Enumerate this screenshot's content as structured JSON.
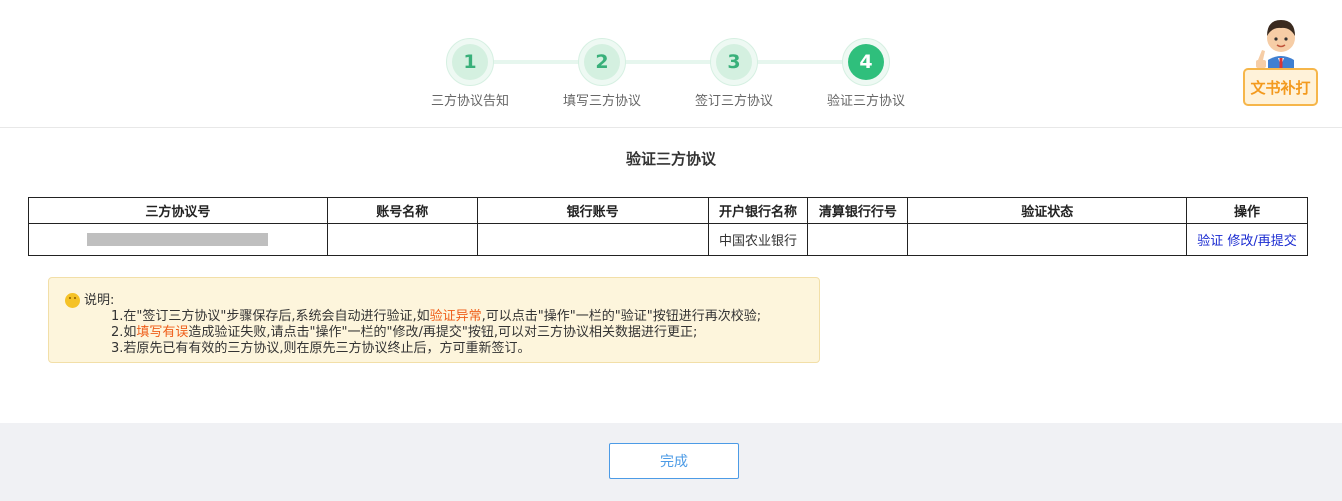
{
  "steps": [
    {
      "number": "1",
      "label": "三方协议告知"
    },
    {
      "number": "2",
      "label": "填写三方协议"
    },
    {
      "number": "3",
      "label": "签订三方协议"
    },
    {
      "number": "4",
      "label": "验证三方协议"
    }
  ],
  "active_step": 4,
  "badge": {
    "label": "文书补打"
  },
  "page_title": "验证三方协议",
  "table": {
    "headers": [
      "三方协议号",
      "账号名称",
      "银行账号",
      "开户银行名称",
      "清算银行行号",
      "验证状态",
      "操作"
    ],
    "rows": [
      {
        "agreement_no": "",
        "account_name": "",
        "bank_account": "",
        "bank_name": "中国农业银行",
        "clearing_no": "",
        "status": "",
        "actions": [
          "验证",
          "修改/再提交"
        ]
      }
    ]
  },
  "notice": {
    "title": "说明:",
    "line1_a": "1.在\"签订三方协议\"步骤保存后,系统会自动进行验证,如",
    "line1_warn": "验证异常",
    "line1_b": ",可以点击\"操作\"一栏的\"验证\"按钮进行再次校验;",
    "line2_a": "2.如",
    "line2_warn": "填写有误",
    "line2_b": "造成验证失败,请点击\"操作\"一栏的\"修改/再提交\"按钮,可以对三方协议相关数据进行更正;",
    "line3": "3.若原先已有有效的三方协议,则在原先三方协议终止后，方可重新签订。"
  },
  "footer": {
    "done_label": "完成"
  },
  "colors": {
    "accent_green": "#2fbf7c",
    "link_blue": "#1a2bd1",
    "warn_orange": "#ef5e1a",
    "badge_orange": "#f39a1e"
  }
}
